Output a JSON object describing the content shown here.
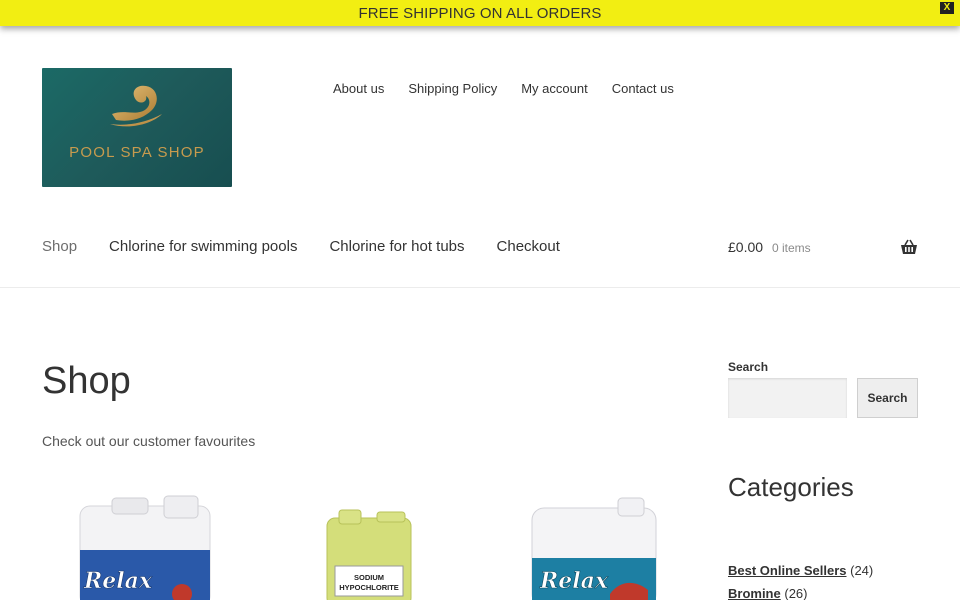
{
  "banner": {
    "text": "FREE SHIPPING ON ALL ORDERS",
    "close": "X"
  },
  "logo": {
    "text": "POOL SPA SHOP"
  },
  "top_nav": [
    "About us",
    "Shipping Policy",
    "My account",
    "Contact us"
  ],
  "main_nav": [
    "Shop",
    "Chlorine for swimming pools",
    "Chlorine for hot tubs",
    "Checkout"
  ],
  "cart": {
    "amount": "£0.00",
    "items": "0 items"
  },
  "page": {
    "title": "Shop",
    "subtitle": "Check out our customer favourites"
  },
  "products": [
    {
      "label": "Relax"
    },
    {
      "label": "SODIUM HYPOCHLORITE"
    },
    {
      "label": "Relax"
    }
  ],
  "sidebar": {
    "search_label": "Search",
    "search_placeholder": "",
    "search_button": "Search",
    "categories_title": "Categories",
    "categories": [
      {
        "name": "Best Online Sellers",
        "count": "(24)"
      },
      {
        "name": "Bromine",
        "count": "(26)"
      }
    ]
  },
  "colors": {
    "banner": "#f2ee12",
    "logo_bg": "#1e5a5a",
    "logo_gold": "#c79b4e"
  },
  "icons": {
    "cart": "basket-icon",
    "close": "close-icon"
  }
}
